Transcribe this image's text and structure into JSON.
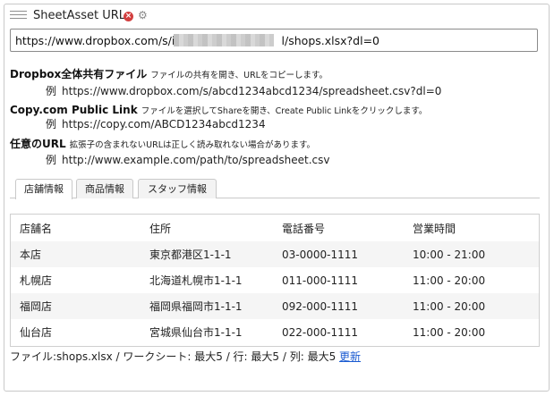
{
  "panel": {
    "title": "SheetAsset URL",
    "icons": {
      "close": "close-icon",
      "settings": "gear-icon",
      "handle": "drag-handle-icon"
    }
  },
  "url_input": {
    "value": "https://www.dropbox.com/s/i                              l/shops.xlsx?dl=0"
  },
  "help": [
    {
      "title": "Dropbox全体共有ファイル",
      "desc": "ファイルの共有を開き、URLをコピーします。",
      "example_prefix": "例",
      "example": "https://www.dropbox.com/s/abcd1234abcd1234/spreadsheet.csv?dl=0"
    },
    {
      "title": "Copy.com Public Link",
      "desc": "ファイルを選択してShareを開き、Create Public Linkをクリックします。",
      "example_prefix": "例",
      "example": "https://copy.com/ABCD1234abcd1234"
    },
    {
      "title": "任意のURL",
      "desc": "拡張子の含まれないURLは正しく読み取れない場合があります。",
      "example_prefix": "例",
      "example": "http://www.example.com/path/to/spreadsheet.csv"
    }
  ],
  "tabs": [
    {
      "label": "店舗情報",
      "active": true
    },
    {
      "label": "商品情報",
      "active": false
    },
    {
      "label": "スタッフ情報",
      "active": false
    }
  ],
  "table": {
    "headers": [
      "店舗名",
      "住所",
      "電話番号",
      "営業時間"
    ],
    "rows": [
      [
        "本店",
        "東京都港区1-1-1",
        "03-0000-1111",
        "10:00 - 21:00"
      ],
      [
        "札幌店",
        "北海道札幌市1-1-1",
        "011-000-1111",
        "11:00 - 20:00"
      ],
      [
        "福岡店",
        "福岡県福岡市1-1-1",
        "092-000-1111",
        "11:00 - 20:00"
      ],
      [
        "仙台店",
        "宮城県仙台市1-1-1",
        "022-000-1111",
        "11:00 - 20:00"
      ]
    ]
  },
  "footer": {
    "text": "ファイル:shops.xlsx / ワークシート: 最大5 / 行: 最大5 / 列: 最大5",
    "link": "更新"
  },
  "colors": {
    "link": "#1a5bd1",
    "close": "#d23f3f",
    "border": "#c9c9c9",
    "row_alt": "#f5f5f5"
  }
}
